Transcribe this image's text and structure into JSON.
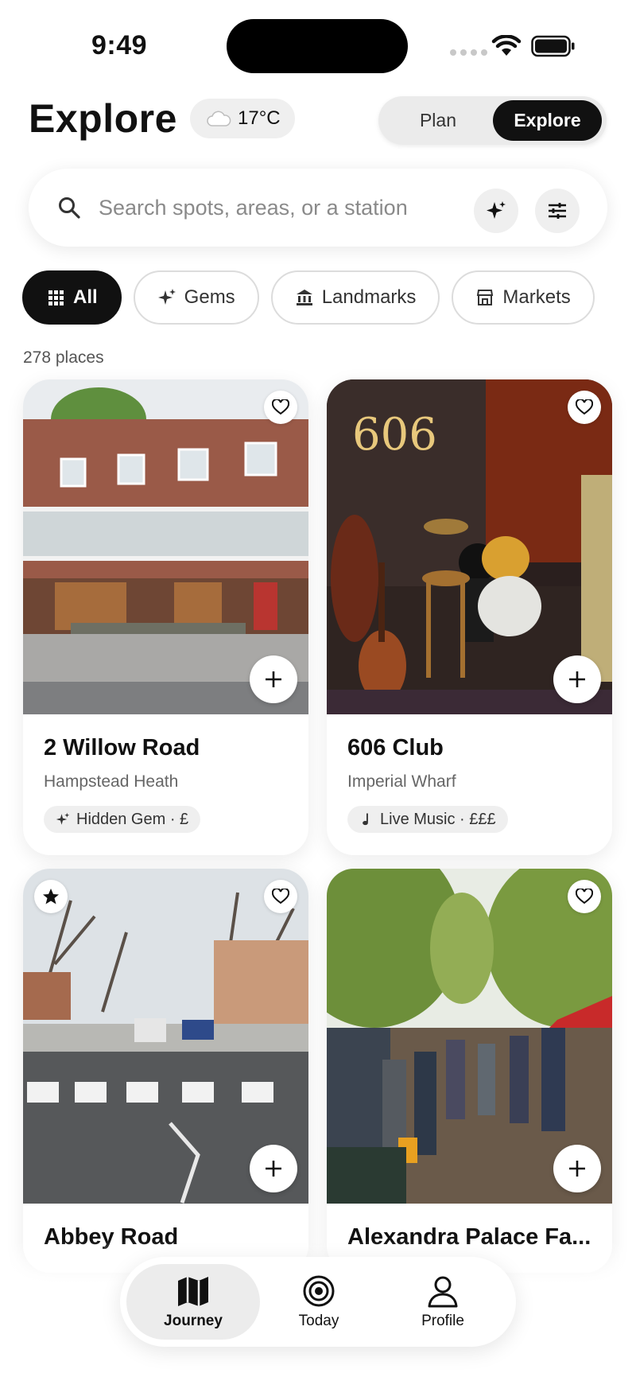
{
  "status_bar": {
    "time": "9:49"
  },
  "header": {
    "title": "Explore",
    "weather": {
      "icon": "cloud-icon",
      "temperature": "17°C"
    },
    "mode_toggle": {
      "options": [
        "Plan",
        "Explore"
      ],
      "selected": "Explore"
    }
  },
  "search": {
    "placeholder": "Search spots, areas, or a station",
    "ai_button_icon": "sparkle-icon",
    "filter_button_icon": "sliders-icon"
  },
  "filters": {
    "chips": [
      {
        "label": "All",
        "icon": "grid-icon",
        "selected": true
      },
      {
        "label": "Gems",
        "icon": "sparkle-icon",
        "selected": false
      },
      {
        "label": "Landmarks",
        "icon": "landmark-icon",
        "selected": false
      },
      {
        "label": "Markets",
        "icon": "storefront-icon",
        "selected": false
      }
    ]
  },
  "results": {
    "count_label": "278 places",
    "places": [
      {
        "name": "2 Willow Road",
        "area": "Hampstead Heath",
        "tag": "Hidden Gem · £",
        "tag_icon": "sparkle-icon",
        "featured": false
      },
      {
        "name": "606 Club",
        "area": "Imperial Wharf",
        "tag": "Live Music · £££",
        "tag_icon": "music-note-icon",
        "featured": false
      },
      {
        "name": "Abbey Road",
        "area": "",
        "tag": "",
        "featured": true
      },
      {
        "name": "Alexandra Palace Fa...",
        "area": "",
        "tag": "",
        "featured": false
      }
    ]
  },
  "bottom_nav": {
    "items": [
      {
        "label": "Journey",
        "icon": "map-icon",
        "active": true
      },
      {
        "label": "Today",
        "icon": "target-icon",
        "active": false
      },
      {
        "label": "Profile",
        "icon": "person-icon",
        "active": false
      }
    ]
  },
  "colors": {
    "accent": "#111111",
    "chip_border": "#dcdcdc",
    "surface": "#efefef"
  }
}
